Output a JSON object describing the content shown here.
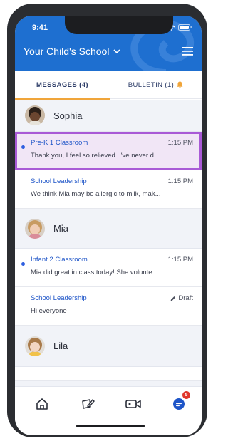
{
  "status_bar": {
    "time": "9:41"
  },
  "header": {
    "school_title": "Your Child's School"
  },
  "tabs": [
    {
      "label": "MESSAGES (4)",
      "active": true
    },
    {
      "label": "BULLETIN (1)",
      "active": false
    }
  ],
  "groups": [
    {
      "name": "Sophia",
      "threads": [
        {
          "name": "Pre-K 1 Classroom",
          "time": "1:15 PM",
          "preview": "Thank you, I feel so relieved. I've never d...",
          "unread": true,
          "selected": true
        },
        {
          "name": "School Leadership",
          "time": "1:15 PM",
          "preview": "We think Mia may be allergic to milk, mak...",
          "unread": false,
          "selected": false
        }
      ]
    },
    {
      "name": "Mia",
      "threads": [
        {
          "name": "Infant 2 Classroom",
          "time": "1:15 PM",
          "preview": "Mia did great in class today! She volunte...",
          "unread": true,
          "selected": false
        },
        {
          "name": "School Leadership",
          "time": "Draft",
          "preview": "Hi everyone",
          "unread": false,
          "selected": false,
          "draft": true
        }
      ]
    },
    {
      "name": "Lila",
      "threads": []
    }
  ],
  "bottom_nav": {
    "items": [
      "home-icon",
      "compose-icon",
      "video-icon",
      "chat-icon"
    ],
    "chat_badge": "5"
  },
  "colors": {
    "brand": "#1e6fd0",
    "accent": "#f0a53a",
    "selection": "#a95ad6",
    "unread": "#2f5fe0",
    "badge": "#e0362c"
  }
}
